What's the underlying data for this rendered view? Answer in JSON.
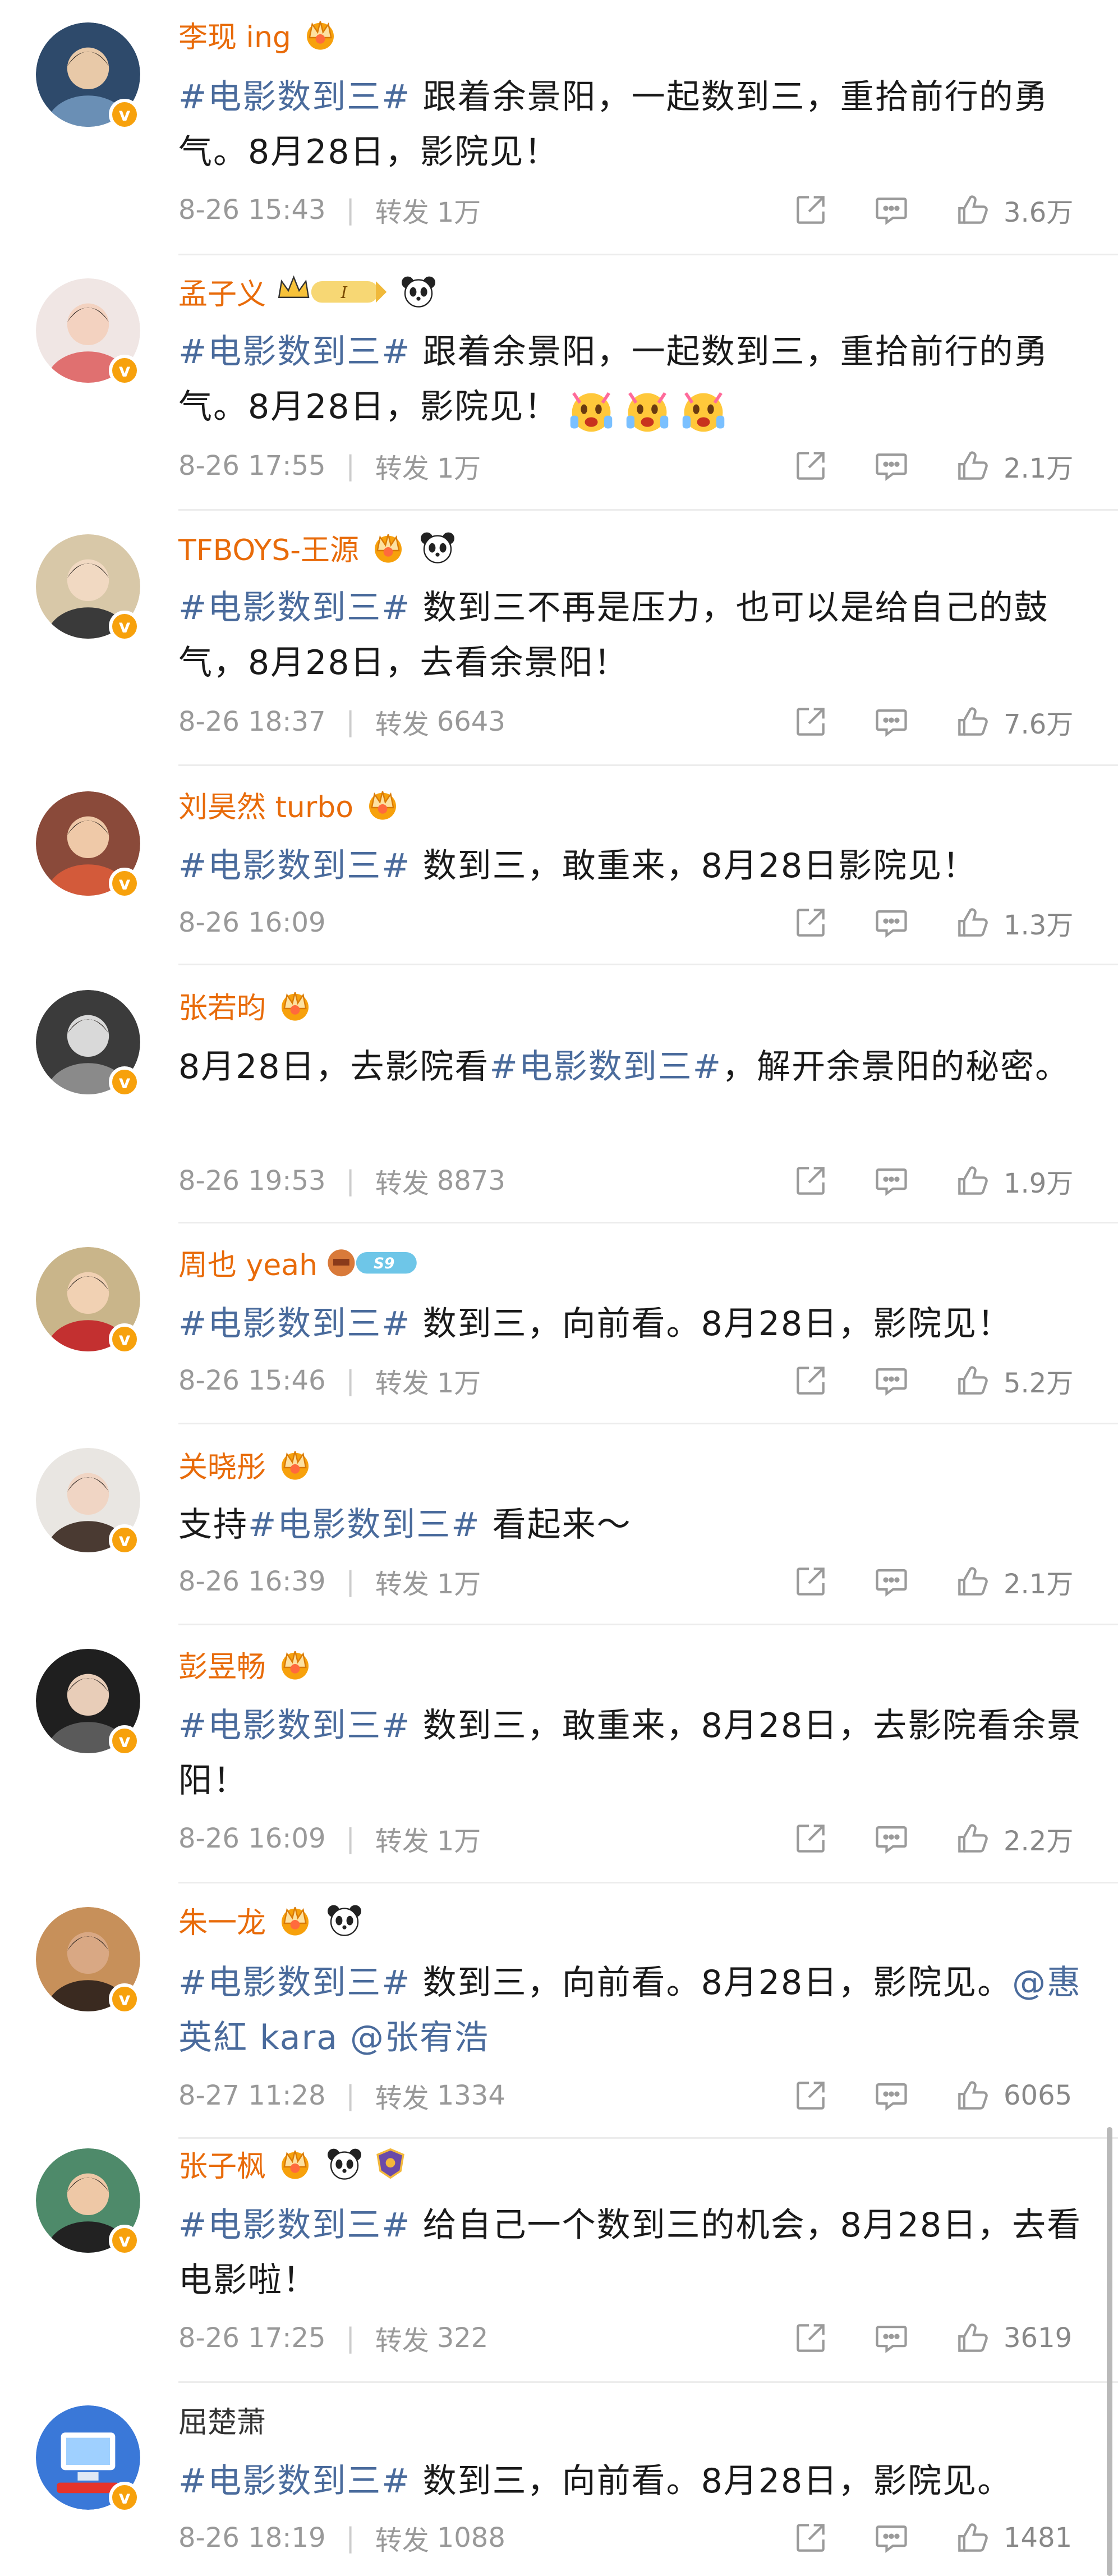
{
  "comments": [
    {
      "name": "李现 ing",
      "text_parts": [
        {
          "t": "#电影数到三#",
          "k": "topic"
        },
        {
          "t": " 跟着余景阳，一起数到三，重拾前行的勇气。8月28日，影院见！",
          "k": "plain"
        }
      ],
      "time": "8-26 15:43",
      "repost_label": "转发",
      "repost": "1万",
      "likes": "3.6万"
    },
    {
      "name": "孟子义",
      "text_parts": [
        {
          "t": "#电影数到三#",
          "k": "topic"
        },
        {
          "t": " 跟着余景阳，一起数到三，重拾前行的勇气。8月28日，影院见！",
          "k": "plain"
        }
      ],
      "time": "8-26 17:55",
      "repost_label": "转发",
      "repost": "1万",
      "likes": "2.1万"
    },
    {
      "name": "TFBOYS-王源",
      "text_parts": [
        {
          "t": "#电影数到三#",
          "k": "topic"
        },
        {
          "t": " 数到三不再是压力，也可以是给自己的鼓气，8月28日，去看余景阳！",
          "k": "plain"
        }
      ],
      "time": "8-26 18:37",
      "repost_label": "转发",
      "repost": "6643",
      "likes": "7.6万"
    },
    {
      "name": "刘昊然 turbo",
      "text_parts": [
        {
          "t": "#电影数到三#",
          "k": "topic"
        },
        {
          "t": " 数到三，敢重来，8月28日影院见！",
          "k": "plain"
        }
      ],
      "time": "8-26 16:09",
      "repost_label": "",
      "repost": "",
      "likes": "1.3万"
    },
    {
      "name": "张若昀",
      "text_parts": [
        {
          "t": "8月28日，去影院看",
          "k": "plain"
        },
        {
          "t": "#电影数到三#",
          "k": "topic"
        },
        {
          "t": "，解开余景阳的秘密。",
          "k": "plain"
        }
      ],
      "time": "8-26 19:53",
      "repost_label": "转发",
      "repost": "8873",
      "likes": "1.9万"
    },
    {
      "name": "周也 yeah",
      "text_parts": [
        {
          "t": "#电影数到三#",
          "k": "topic"
        },
        {
          "t": " 数到三，向前看。8月28日，影院见！",
          "k": "plain"
        }
      ],
      "time": "8-26 15:46",
      "repost_label": "转发",
      "repost": "1万",
      "likes": "5.2万"
    },
    {
      "name": "关晓彤",
      "text_parts": [
        {
          "t": "支持",
          "k": "plain"
        },
        {
          "t": "#电影数到三#",
          "k": "topic"
        },
        {
          "t": " 看起来～",
          "k": "plain"
        }
      ],
      "time": "8-26 16:39",
      "repost_label": "转发",
      "repost": "1万",
      "likes": "2.1万"
    },
    {
      "name": "彭昱畅",
      "text_parts": [
        {
          "t": "#电影数到三#",
          "k": "topic"
        },
        {
          "t": " 数到三，敢重来，8月28日，去影院看余景阳！",
          "k": "plain"
        }
      ],
      "time": "8-26 16:09",
      "repost_label": "转发",
      "repost": "1万",
      "likes": "2.2万"
    },
    {
      "name": "朱一龙",
      "text_parts": [
        {
          "t": "#电影数到三#",
          "k": "topic"
        },
        {
          "t": " 数到三，向前看。8月28日，影院见。",
          "k": "plain"
        },
        {
          "t": "@惠英紅 kara",
          "k": "mention"
        },
        {
          "t": " ",
          "k": "plain"
        },
        {
          "t": "@张宥浩",
          "k": "mention"
        }
      ],
      "time": "8-27 11:28",
      "repost_label": "转发",
      "repost": "1334",
      "likes": "6065"
    },
    {
      "name": "张子枫",
      "text_parts": [
        {
          "t": "#电影数到三#",
          "k": "topic"
        },
        {
          "t": " 给自己一个数到三的机会，8月28日，去看电影啦！",
          "k": "plain"
        }
      ],
      "time": "8-26 17:25",
      "repost_label": "转发",
      "repost": "322",
      "likes": "3619"
    },
    {
      "name": "屈楚萧",
      "text_parts": [
        {
          "t": "#电影数到三#",
          "k": "topic"
        },
        {
          "t": " 数到三，向前看。8月28日，影院见。",
          "k": "plain"
        }
      ],
      "time": "8-26 18:19",
      "repost_label": "转发",
      "repost": "1088",
      "likes": "1481"
    }
  ],
  "icons": {
    "share": "share-icon",
    "comment": "comment-icon",
    "like": "like-icon",
    "verified": "verified-v-icon"
  },
  "colors": {
    "name": "#e86b0a",
    "topic": "#4a6b9c",
    "meta": "#999999",
    "verified": "#f7a10c"
  }
}
